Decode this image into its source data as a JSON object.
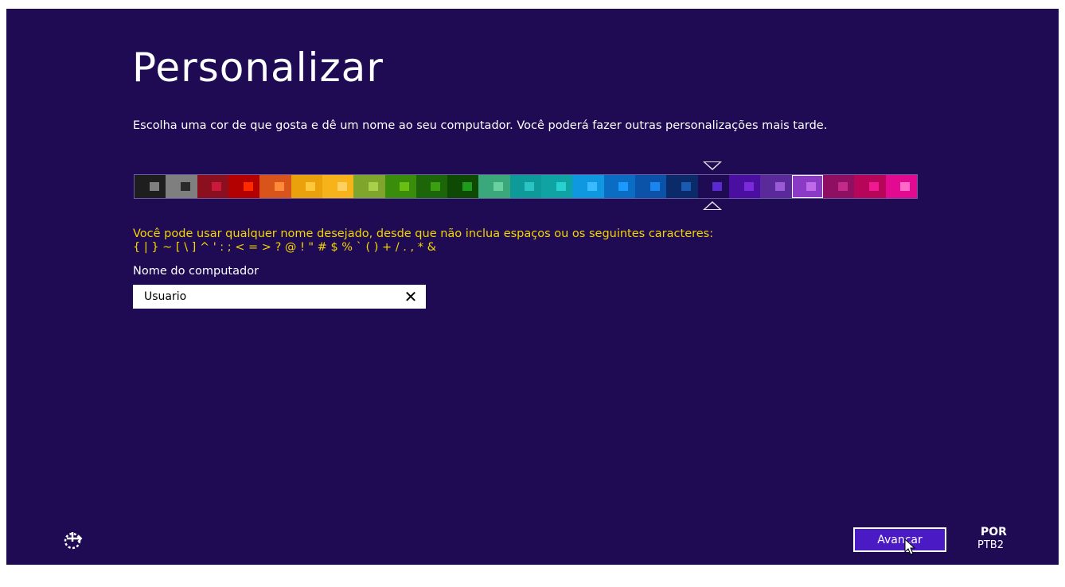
{
  "page": {
    "title": "Personalizar",
    "description": "Escolha uma cor de que gosta e dê um nome ao seu computador. Você poderá fazer outras personalizações mais tarde."
  },
  "palette": {
    "selected_index": 21,
    "swatches": [
      {
        "bg": "#1e1e1e",
        "fg": "#7f7f7f"
      },
      {
        "bg": "#7f7f7f",
        "fg": "#2a2a2a"
      },
      {
        "bg": "#8b0f1f",
        "fg": "#c81a3a"
      },
      {
        "bg": "#b30000",
        "fg": "#ff2a00"
      },
      {
        "bg": "#d9541b",
        "fg": "#ff8a3a"
      },
      {
        "bg": "#eba10c",
        "fg": "#ffc83a"
      },
      {
        "bg": "#f6b41a",
        "fg": "#ffd060"
      },
      {
        "bg": "#7fa52b",
        "fg": "#a8d04a"
      },
      {
        "bg": "#3a8d0b",
        "fg": "#6ac012"
      },
      {
        "bg": "#1c6509",
        "fg": "#3aa012"
      },
      {
        "bg": "#0f4a05",
        "fg": "#1e9b1a"
      },
      {
        "bg": "#3aa87a",
        "fg": "#6ad0a0"
      },
      {
        "bg": "#0f9a9a",
        "fg": "#2ac4c4"
      },
      {
        "bg": "#0fa3a3",
        "fg": "#28d0d0"
      },
      {
        "bg": "#0f97e0",
        "fg": "#3abaff"
      },
      {
        "bg": "#0b6cc4",
        "fg": "#1a9aff"
      },
      {
        "bg": "#0a53a8",
        "fg": "#1a84f0"
      },
      {
        "bg": "#0a2a6a",
        "fg": "#1a5ab0"
      },
      {
        "bg": "#1e0b54",
        "fg": "#5a2ad0"
      },
      {
        "bg": "#4a0ea0",
        "fg": "#7a2ad8"
      },
      {
        "bg": "#5b2a9a",
        "fg": "#9a5ad8"
      },
      {
        "bg": "#8a3ac4",
        "fg": "#c06ae8"
      },
      {
        "bg": "#8f0f62",
        "fg": "#c42a8a"
      },
      {
        "bg": "#b7055a",
        "fg": "#f01a90"
      },
      {
        "bg": "#e20a90",
        "fg": "#ff6ac8"
      }
    ]
  },
  "naming": {
    "hint_line1": "Você pode usar qualquer nome desejado, desde que não inclua espaços ou os seguintes caracteres:",
    "hint_line2": "{ | } ~ [ \\ ] ^ ' : ; < = > ? @ ! \" # $ % ` ( ) + / . , * &",
    "label": "Nome do computador",
    "value": "Usuario",
    "clear_glyph": "✕"
  },
  "footer": {
    "accessibility_icon": "ease-of-access-icon",
    "next_label": "Avançar",
    "lang_code": "POR",
    "lang_layout": "PTB2"
  },
  "colors": {
    "background": "#1e0b54",
    "accent": "#4a1bc4",
    "hint": "#f4d500"
  }
}
